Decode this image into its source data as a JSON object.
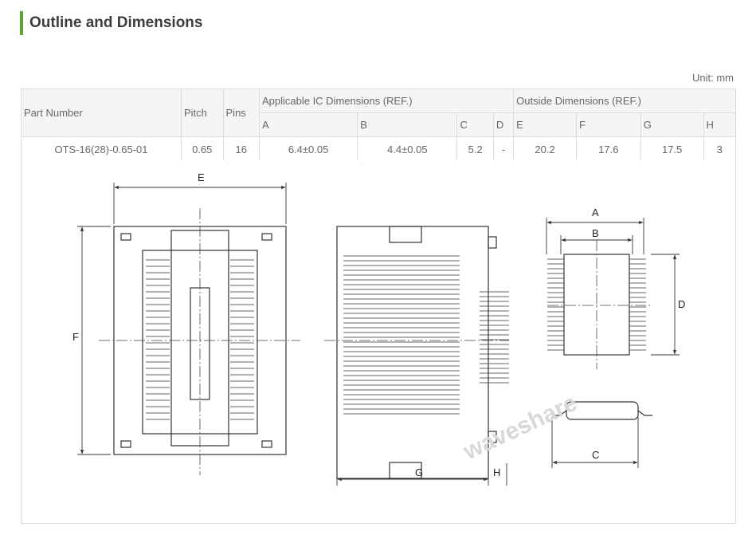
{
  "page": {
    "title": "Outline and Dimensions",
    "unit_label": "Unit: mm",
    "accent": "#5aa832"
  },
  "table": {
    "part_number_header": "Part Number",
    "pitch_header": "Pitch",
    "pins_header": "Pins",
    "applicable_group": "Applicable IC Dimensions (REF.)",
    "outside_group": "Outside Dimensions (REF.)",
    "sub": {
      "A": "A",
      "B": "B",
      "C": "C",
      "D": "D",
      "E": "E",
      "F": "F",
      "G": "G",
      "H": "H"
    },
    "row": {
      "part": "OTS-16(28)-0.65-01",
      "pitch": "0.65",
      "pins": "16",
      "A": "6.4±0.05",
      "B": "4.4±0.05",
      "C": "5.2",
      "D": "-",
      "E": "20.2",
      "F": "17.6",
      "G": "17.5",
      "H": "3"
    }
  },
  "drawing": {
    "labels": {
      "E": "E",
      "F": "F",
      "G": "G",
      "H": "H",
      "A": "A",
      "B": "B",
      "C": "C",
      "D": "D"
    },
    "watermark": "waveshare"
  }
}
